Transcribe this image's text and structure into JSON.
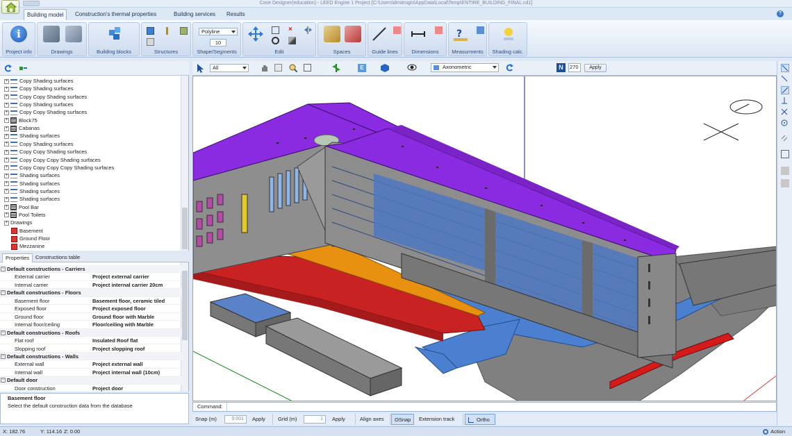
{
  "window": {
    "title": "Cove Designer(education) - LEED Engine 1 Project [C:\\Users\\dimitrogis\\AppData\\Local\\Temp\\ENTIRE_BUILDING_FINAL.cd1]"
  },
  "tabs": [
    {
      "label": "Building model",
      "active": true
    },
    {
      "label": "Construction's thermal properties",
      "active": false
    },
    {
      "label": "Building services",
      "active": false
    },
    {
      "label": "Results",
      "active": false
    }
  ],
  "ribbon": {
    "project_info": "Project info",
    "drawings": "Drawings",
    "building_blocks": "Building blocks",
    "structures": "Structures",
    "shape_segments": "Shape/Segments",
    "shape_mode": "Polyline",
    "shape_count": "10",
    "edit": "Edit",
    "spaces": "Spaces",
    "guide_lines": "Guide lines",
    "dimensions": "Dimensions",
    "measurements": "Measurments",
    "shading_calc": "Shading calc."
  },
  "tree": {
    "items": [
      {
        "label": "Copy Shading surfaces",
        "type": "shade"
      },
      {
        "label": "Copy Shading surfaces",
        "type": "shade"
      },
      {
        "label": "Copy Copy Shading surfaces",
        "type": "shade"
      },
      {
        "label": "Copy Shading surfaces",
        "type": "shade"
      },
      {
        "label": "Copy Copy Shading surfaces",
        "type": "shade"
      },
      {
        "label": "Block75",
        "type": "block"
      },
      {
        "label": "Cabanas",
        "type": "block"
      },
      {
        "label": "Shading surfaces",
        "type": "shade"
      },
      {
        "label": "Copy Shading surfaces",
        "type": "shade"
      },
      {
        "label": "Copy Copy Shading surfaces",
        "type": "shade"
      },
      {
        "label": "Copy Copy Copy Shading surfaces",
        "type": "shade"
      },
      {
        "label": "Copy Copy Copy Copy Shading surfaces",
        "type": "shade"
      },
      {
        "label": "Shading surfaces",
        "type": "shade"
      },
      {
        "label": "Shading surfaces",
        "type": "shade"
      },
      {
        "label": "Shading surfaces",
        "type": "shade"
      },
      {
        "label": "Shading surfaces",
        "type": "shade"
      },
      {
        "label": "Pool Bar",
        "type": "block"
      },
      {
        "label": "Pool Toilets",
        "type": "block"
      },
      {
        "label": "Drawings",
        "type": "root"
      },
      {
        "label": "Basement",
        "type": "draw"
      },
      {
        "label": "Ground Floor",
        "type": "draw"
      },
      {
        "label": "Mezzanine",
        "type": "draw"
      }
    ]
  },
  "prop_tabs": [
    {
      "label": "Properties",
      "active": true
    },
    {
      "label": "Constructions table",
      "active": false
    }
  ],
  "properties": [
    {
      "header": "Default constructions - Carriers"
    },
    {
      "key": "External carrier",
      "value": "Project external carrier"
    },
    {
      "key": "Internal carrier",
      "value": "Project internal carrier 20cm"
    },
    {
      "header": "Default constructions - Floors"
    },
    {
      "key": "Basement floor",
      "value": "Basement floor, ceramic tiled"
    },
    {
      "key": "Exposed floor",
      "value": "Project exposed floor"
    },
    {
      "key": "Ground floor",
      "value": "Ground floor with Marble"
    },
    {
      "key": "Internal floor/ceiling",
      "value": "Floor/ceiling with Marble"
    },
    {
      "header": "Default constructions - Roofs"
    },
    {
      "key": "Flat roof",
      "value": "Insulated Roof flat"
    },
    {
      "key": "Slopping roof",
      "value": "Project slopping roof"
    },
    {
      "header": "Default constructions - Walls"
    },
    {
      "key": "External wall",
      "value": "Project external wall"
    },
    {
      "key": "Internal wall",
      "value": "Project internal wall (10cm)"
    },
    {
      "header": "Default door"
    },
    {
      "key": "Door construction",
      "value": "Project door"
    }
  ],
  "description": {
    "title": "Basement floor",
    "text": "Select the default construction data from the database"
  },
  "view_toolbar": {
    "filter": "All",
    "view_mode": "Axonometric",
    "north_label": "N",
    "north_angle": "270",
    "apply": "Apply",
    "e_label": "E"
  },
  "command": {
    "label": "Command:"
  },
  "snapbar": {
    "snap_label": "Snap (m)",
    "snap_value": "0.001",
    "apply1": "Apply",
    "grid_label": "Grid (m)",
    "grid_value": "1",
    "apply2": "Apply",
    "align_axes": "Align axes",
    "osnap": "OSnap",
    "extension_track": "Extension track",
    "ortho": "Ortho"
  },
  "status": {
    "x": "X: 182.76",
    "y": "Y: 114.16",
    "z": "Z: 0.00",
    "action": "Action"
  },
  "colors": {
    "roof": "#8a2be2",
    "floor_slab": "#4a7fd6",
    "facade": "#8f8f8f",
    "accent_red": "#d01818",
    "accent_orange": "#e89010",
    "ribbon_blue": "#2b4c7e"
  }
}
